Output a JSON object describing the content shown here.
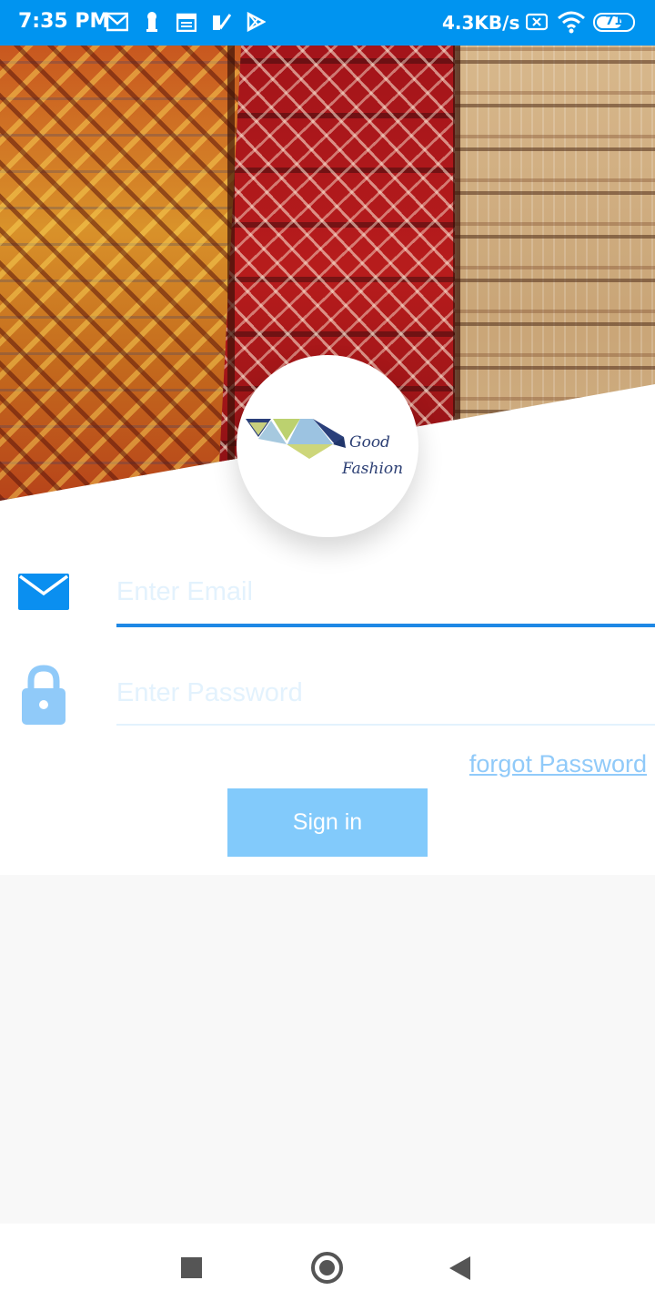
{
  "status_bar": {
    "time": "7:35 PM",
    "network_speed": "4.3KB/s",
    "battery": "71",
    "battery_level": 0.71,
    "icons": [
      "gmail-icon",
      "keyhole-icon",
      "calendar-icon",
      "check-icon",
      "play-store-icon",
      "sim-x-icon",
      "wifi-icon",
      "battery-icon"
    ]
  },
  "header": {
    "background_image": "woven-rugs-photo",
    "logo_line1": "Good",
    "logo_line2": "Fashion"
  },
  "form": {
    "email_placeholder": "Enter Email",
    "email_value": "",
    "password_placeholder": "Enter Password",
    "password_value": "",
    "forgot_password": "forgot Password",
    "sign_in": "Sign in"
  },
  "colors": {
    "status_bar": "#0094f0",
    "accent": "#1e88e5",
    "button": "#82cafb",
    "link": "#90caf9"
  },
  "nav_bar": {
    "icons": [
      "recents-square-icon",
      "home-circle-icon",
      "back-triangle-icon"
    ]
  }
}
